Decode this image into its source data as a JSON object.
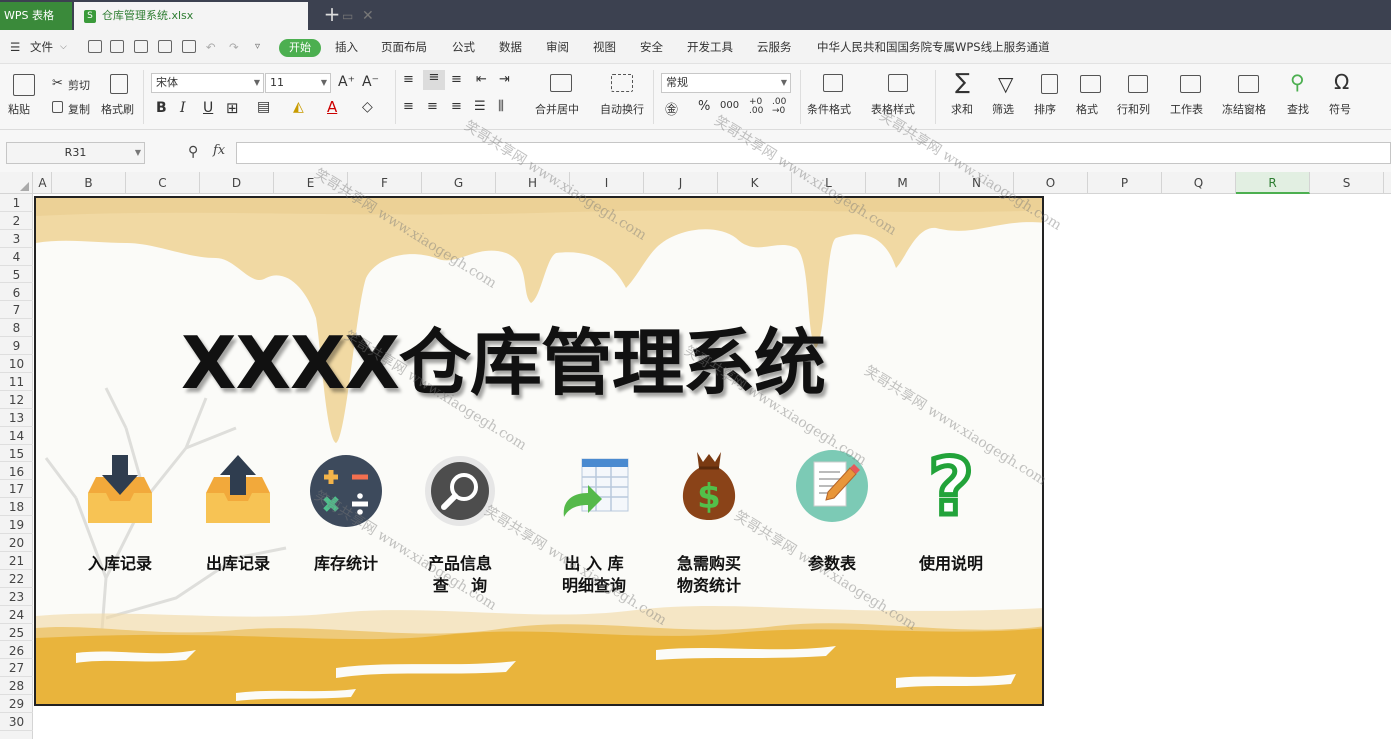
{
  "titlebar": {
    "app_tab": "WPS 表格",
    "file_tab": "仓库管理系统.xlsx",
    "new_tab": "+"
  },
  "menubar": {
    "file": "文件",
    "items": [
      "开始",
      "插入",
      "页面布局",
      "公式",
      "数据",
      "审阅",
      "视图",
      "安全",
      "开发工具",
      "云服务",
      "中华人民共和国国务院专属WPS线上服务通道"
    ]
  },
  "ribbon": {
    "paste": "粘贴",
    "cut": "剪切",
    "copy": "复制",
    "format_painter": "格式刷",
    "font_name": "宋体",
    "font_size": "11",
    "merge_center": "合并居中",
    "wrap_text": "自动换行",
    "number_format": "常规",
    "conditional_format": "条件格式",
    "table_style": "表格样式",
    "sum": "求和",
    "filter": "筛选",
    "sort": "排序",
    "format": "格式",
    "rows_cols": "行和列",
    "worksheet": "工作表",
    "freeze": "冻结窗格",
    "find": "查找",
    "symbol": "符号"
  },
  "formula": {
    "cell_ref": "R31",
    "fx": "fx",
    "value": ""
  },
  "grid": {
    "columns": [
      "A",
      "B",
      "C",
      "D",
      "E",
      "F",
      "G",
      "H",
      "I",
      "J",
      "K",
      "L",
      "M",
      "N",
      "O",
      "P",
      "Q",
      "R",
      "S"
    ],
    "selected_column": "R",
    "rows": [
      "1",
      "2",
      "3",
      "4",
      "5",
      "6",
      "7",
      "8",
      "9",
      "10",
      "11",
      "12",
      "13",
      "14",
      "15",
      "16",
      "17",
      "18",
      "19",
      "20",
      "21",
      "22",
      "23",
      "24",
      "25",
      "26",
      "27",
      "28",
      "29",
      "30"
    ]
  },
  "banner": {
    "title": "XXXX仓库管理系统",
    "tiles": [
      {
        "label": "入库记录",
        "icon": "inbox-down-icon"
      },
      {
        "label": "出库记录",
        "icon": "inbox-up-icon"
      },
      {
        "label": "库存统计",
        "icon": "calculator-icon"
      },
      {
        "label": "产品信息\n查    询",
        "icon": "magnifier-icon"
      },
      {
        "label": "出 入 库\n明细查询",
        "icon": "spreadsheet-arrow-icon"
      },
      {
        "label": "急需购买\n物资统计",
        "icon": "money-bag-icon"
      },
      {
        "label": "参数表",
        "icon": "notepad-pencil-icon"
      },
      {
        "label": "使用说明",
        "icon": "question-mark-icon"
      }
    ]
  },
  "watermark": {
    "cn": "笑哥共享网",
    "url": "www.xiaogegh.com"
  },
  "colors": {
    "accent_green": "#4caf50",
    "tab_bar": "#3c4150",
    "banner_yellow": "#e9b43c",
    "banner_cream": "#f1d9a3"
  }
}
